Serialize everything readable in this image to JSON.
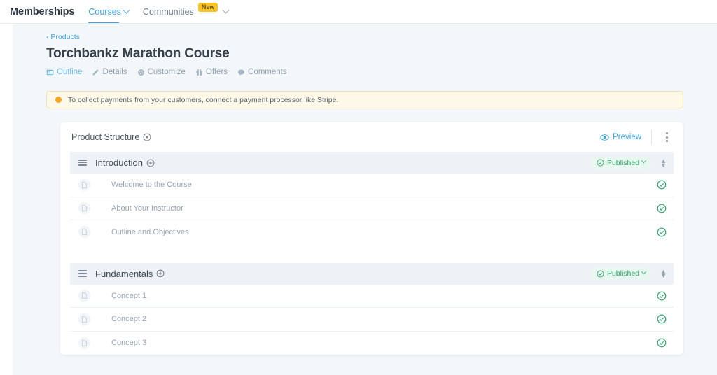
{
  "topnav": {
    "brand": "Memberships",
    "items": [
      {
        "label": "Courses",
        "icon": "chevron-down-icon",
        "active": true,
        "badge": ""
      },
      {
        "label": "Communities",
        "icon": "chevron-down-icon",
        "active": false,
        "badge": "New"
      }
    ]
  },
  "breadcrumb": {
    "label": "Products",
    "icon": "chevron-left-icon"
  },
  "page": {
    "title": "Torchbankz Marathon Course"
  },
  "subtabs": [
    {
      "label": "Outline",
      "icon": "layout-icon",
      "active": true
    },
    {
      "label": "Details",
      "icon": "pencil-icon",
      "active": false
    },
    {
      "label": "Customize",
      "icon": "palette-icon",
      "active": false
    },
    {
      "label": "Offers",
      "icon": "gift-icon",
      "active": false
    },
    {
      "label": "Comments",
      "icon": "comment-icon",
      "active": false
    }
  ],
  "alert": {
    "icon": "warning-dot-icon",
    "text": "To collect payments from your customers, connect a payment processor like Stripe."
  },
  "card": {
    "title": "Product Structure",
    "title_icon": "info-circle-icon",
    "preview_label": "Preview",
    "preview_icon": "eye-icon",
    "menu_icon": "kebab-menu-icon"
  },
  "sections": [
    {
      "name": "Introduction",
      "drag_icon": "drag-handle-icon",
      "add_icon": "plus-circle-icon",
      "status": "Published",
      "status_icon": "check-circle-icon",
      "status_caret": "chevron-down-icon",
      "sort_icon": "sort-updown-icon",
      "lessons": [
        {
          "name": "Welcome to the Course",
          "icon": "document-icon",
          "status_icon": "check-circle-icon"
        },
        {
          "name": "About Your Instructor",
          "icon": "document-icon",
          "status_icon": "check-circle-icon"
        },
        {
          "name": "Outline and Objectives",
          "icon": "document-icon",
          "status_icon": "check-circle-icon"
        }
      ]
    },
    {
      "name": "Fundamentals",
      "drag_icon": "drag-handle-icon",
      "add_icon": "plus-circle-icon",
      "status": "Published",
      "status_icon": "check-circle-icon",
      "status_caret": "chevron-down-icon",
      "sort_icon": "sort-updown-icon",
      "lessons": [
        {
          "name": "Concept 1",
          "icon": "document-icon",
          "status_icon": "check-circle-icon"
        },
        {
          "name": "Concept 2",
          "icon": "document-icon",
          "status_icon": "check-circle-icon"
        },
        {
          "name": "Concept 3",
          "icon": "document-icon",
          "status_icon": "check-circle-icon"
        }
      ]
    }
  ],
  "colors": {
    "accent_blue": "#3ba3e0",
    "published_green": "#2fa36b",
    "alert_yellow": "#fdf8e8",
    "badge_gold": "#f7c325",
    "page_bg": "#f4f7fa"
  }
}
